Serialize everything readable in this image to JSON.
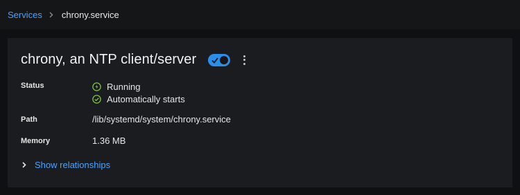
{
  "breadcrumb": {
    "parent": "Services",
    "current": "chrony.service"
  },
  "service": {
    "title": "chrony, an NTP client/server",
    "enabled": true,
    "status_label": "Status",
    "status_lines": [
      "Running",
      "Automatically starts"
    ],
    "path_label": "Path",
    "path_value": "/lib/systemd/system/chrony.service",
    "memory_label": "Memory",
    "memory_value": "1.36 MB",
    "relationships_link": "Show relationships"
  },
  "colors": {
    "link": "#4aa3ff",
    "toggle_on": "#2b8eea",
    "status_ok": "#7fc447"
  },
  "icons": {
    "breadcrumb_separator": "chevron-right-icon",
    "running": "power-circle-icon",
    "autostart": "check-circle-icon",
    "menu": "kebab-menu-icon",
    "expand": "chevron-right-icon"
  }
}
